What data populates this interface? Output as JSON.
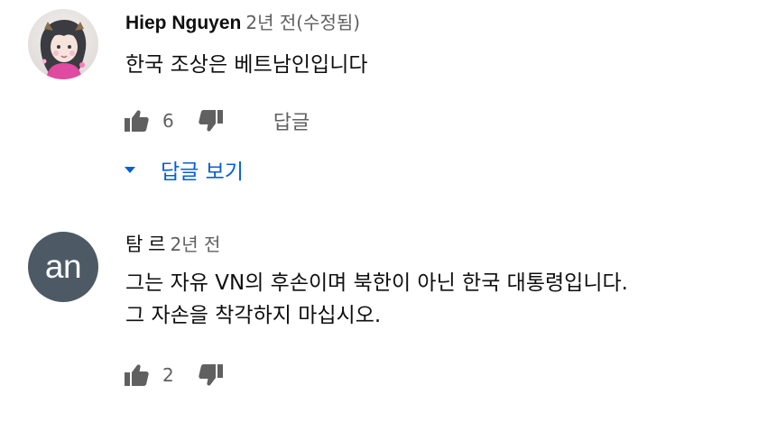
{
  "colors": {
    "text": "#0f0f0f",
    "secondary": "#606060",
    "link": "#065fd4",
    "avatar_initials_bg": "#4d5a66"
  },
  "comments": [
    {
      "author": "Hiep Nguyen",
      "time": "2년 전(수정됨)",
      "text": "한국 조상은 베트남인입니다",
      "likes": "6",
      "reply_label": "답글",
      "avatar_icon": "profile-photo",
      "replies_label": "답글 보기"
    },
    {
      "author": "탐 르",
      "time": "2년 전",
      "avatar_initials": "an",
      "text": "그는 자유 VN의 후손이며 북한이 아닌 한국 대통령입니다.\n그 자손을 착각하지 마십시오.",
      "likes": "2"
    }
  ]
}
